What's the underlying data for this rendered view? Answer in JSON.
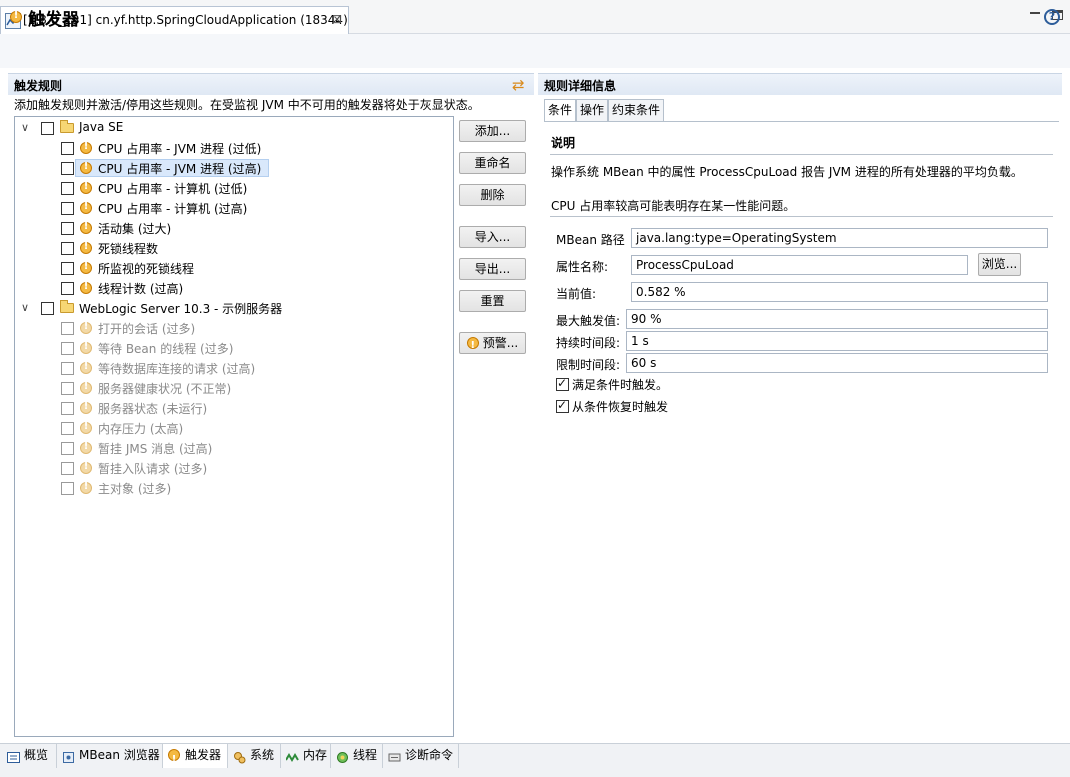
{
  "window": {
    "tab_title": "[1.8.0_131] cn.yf.http.SpringCloudApplication (18344)",
    "close_glyph": "⊠"
  },
  "page": {
    "title": "触发器"
  },
  "rules": {
    "section_title": "触发规则",
    "description": "添加触发规则并激活/停用这些规则。在受监视 JVM 中不可用的触发器将处于灰显状态。",
    "groups": [
      {
        "label": "Java SE",
        "items": [
          {
            "label": "CPU 占用率 - JVM 进程 (过低)",
            "enabled": true
          },
          {
            "label": "CPU 占用率 - JVM 进程 (过高)",
            "enabled": true,
            "selected": true
          },
          {
            "label": "CPU 占用率 - 计算机 (过低)",
            "enabled": true
          },
          {
            "label": "CPU 占用率 - 计算机 (过高)",
            "enabled": true
          },
          {
            "label": "活动集 (过大)",
            "enabled": true
          },
          {
            "label": "死锁线程数",
            "enabled": true
          },
          {
            "label": "所监视的死锁线程",
            "enabled": true
          },
          {
            "label": "线程计数 (过高)",
            "enabled": true
          }
        ]
      },
      {
        "label": "WebLogic Server 10.3 - 示例服务器",
        "items": [
          {
            "label": "打开的会话 (过多)",
            "enabled": false
          },
          {
            "label": "等待 Bean 的线程 (过多)",
            "enabled": false
          },
          {
            "label": "等待数据库连接的请求 (过高)",
            "enabled": false
          },
          {
            "label": "服务器健康状况 (不正常)",
            "enabled": false
          },
          {
            "label": "服务器状态 (未运行)",
            "enabled": false
          },
          {
            "label": "内存压力 (太高)",
            "enabled": false
          },
          {
            "label": "暂挂 JMS 消息 (过高)",
            "enabled": false
          },
          {
            "label": "暂挂入队请求 (过多)",
            "enabled": false
          },
          {
            "label": "主对象 (过多)",
            "enabled": false
          }
        ]
      }
    ],
    "buttons": {
      "add": "添加...",
      "rename": "重命名",
      "delete": "删除",
      "import": "导入...",
      "export": "导出...",
      "reset": "重置",
      "alert": "预警..."
    }
  },
  "details": {
    "section_title": "规则详细信息",
    "tabs": [
      "条件",
      "操作",
      "约束条件"
    ],
    "explain_title": "说明",
    "explain_text1": "操作系统 MBean 中的属性 ProcessCpuLoad 报告 JVM 进程的所有处理器的平均负载。",
    "explain_text2": "CPU 占用率较高可能表明存在某一性能问题。",
    "fields": {
      "mbean_path_label": "MBean 路径",
      "mbean_path_value": "java.lang:type=OperatingSystem",
      "attribute_label": "属性名称:",
      "attribute_value": "ProcessCpuLoad",
      "browse": "浏览...",
      "current_label": "当前值:",
      "current_value": "0.582 %",
      "max_trigger_label": "最大触发值:",
      "max_trigger_value": "90 %",
      "duration_label": "持续时间段:",
      "duration_value": "1 s",
      "limit_label": "限制时间段:",
      "limit_value": "60 s"
    },
    "checks": {
      "on_condition": "满足条件时触发。",
      "on_recover": "从条件恢复时触发"
    }
  },
  "bottom_tabs": [
    {
      "label": "概览"
    },
    {
      "label": "MBean 浏览器"
    },
    {
      "label": "触发器",
      "active": true
    },
    {
      "label": "系统"
    },
    {
      "label": "内存"
    },
    {
      "label": "线程"
    },
    {
      "label": "诊断命令"
    }
  ],
  "colors": {
    "accent": "#2d5d9a",
    "warning": "#f4b942",
    "selection": "#d9e8fb"
  }
}
